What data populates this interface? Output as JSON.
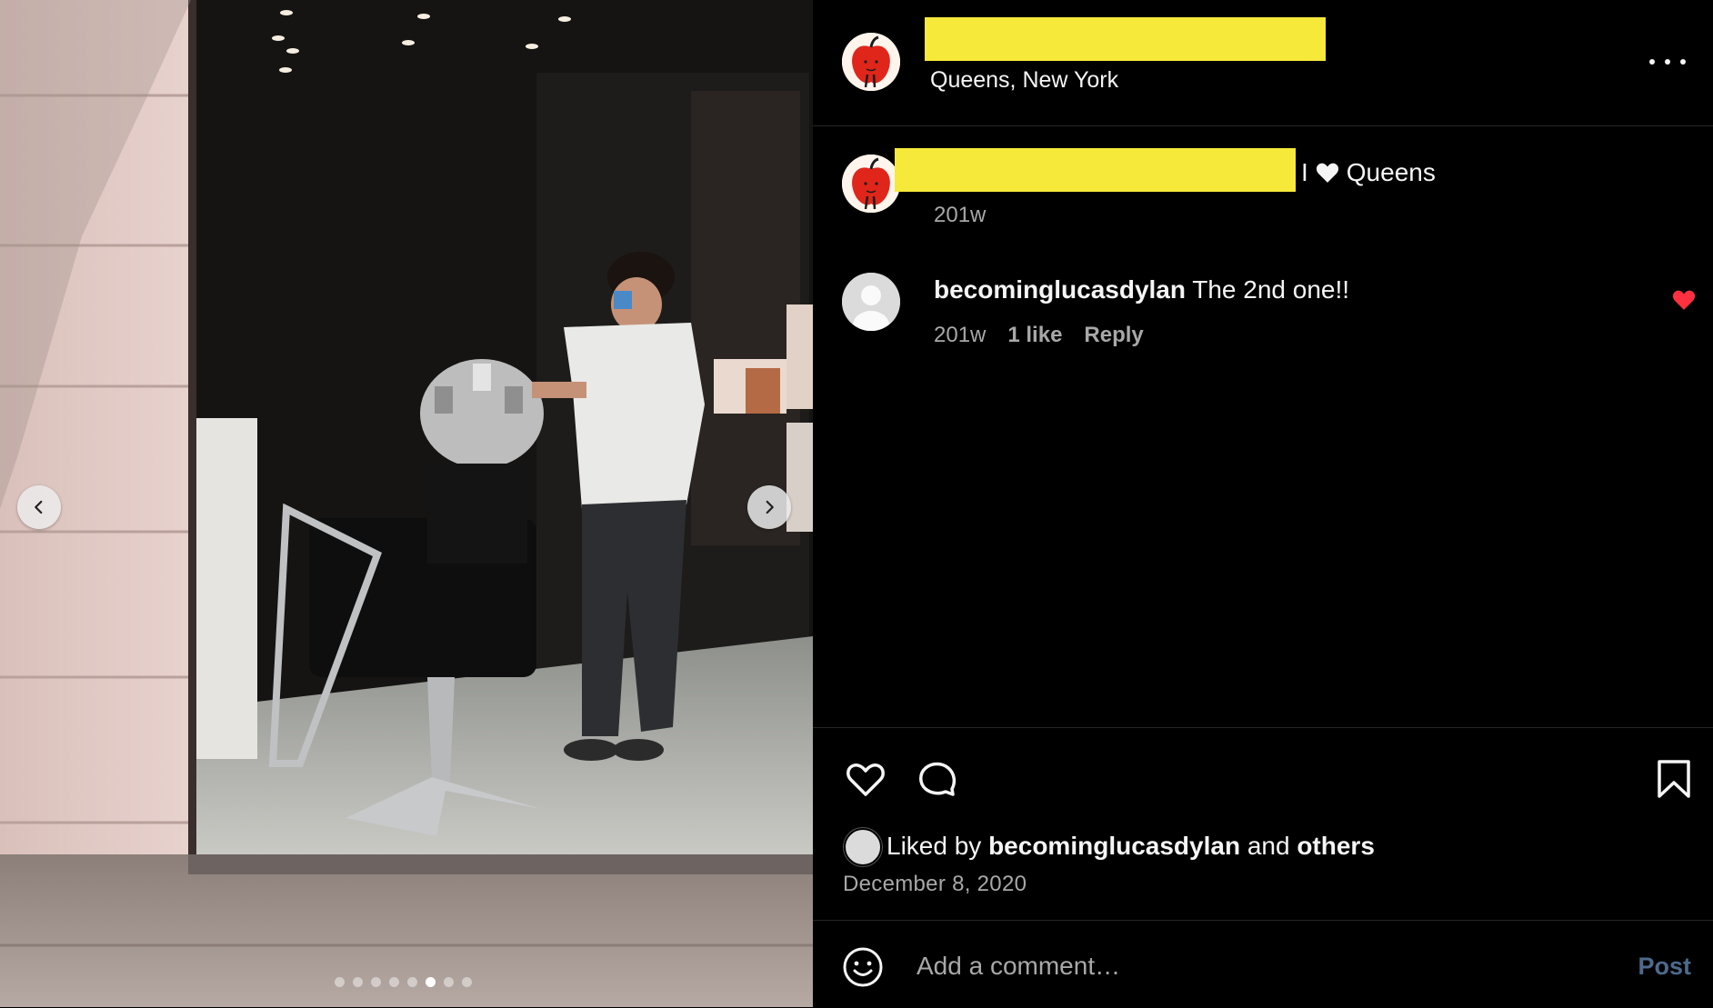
{
  "post": {
    "location": "Queens, New York",
    "more_icon": "more-horizontal-icon"
  },
  "caption": {
    "text": "I",
    "text_after": "Queens",
    "heart_icon": "white-heart-emoji",
    "time": "201w"
  },
  "comments": [
    {
      "username": "becominglucasdylan",
      "text": "The 2nd one!!",
      "time": "201w",
      "likes": "1 like",
      "reply_label": "Reply",
      "liked": true
    }
  ],
  "actions": {
    "like_icon": "heart-outline-icon",
    "comment_icon": "comment-bubble-icon",
    "save_icon": "bookmark-outline-icon"
  },
  "likes": {
    "prefix": "Liked by",
    "user": "becominglucasdylan",
    "connector": "and",
    "others": "others"
  },
  "date": "December 8, 2020",
  "composer": {
    "placeholder": "Add a comment…",
    "post_label": "Post",
    "emoji_icon": "smiley-icon"
  },
  "carousel": {
    "total": 8,
    "active_index": 5
  },
  "colors": {
    "background": "#000000",
    "text": "#f5f5f5",
    "secondary_text": "#a8a8a8",
    "redaction": "#f6e93a",
    "like_red": "#ff3040",
    "post_button": "#4d6a8c"
  }
}
